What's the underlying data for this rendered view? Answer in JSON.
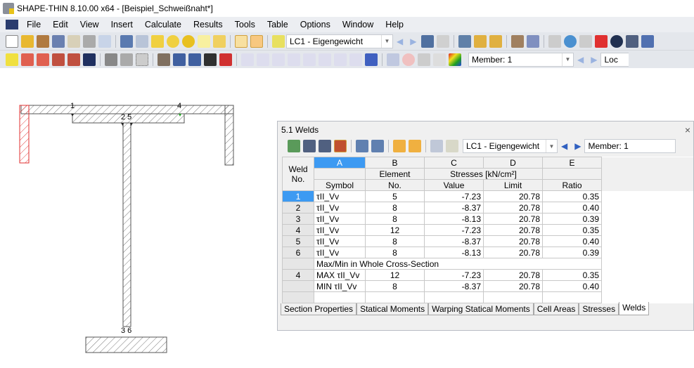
{
  "window": {
    "title": "SHAPE-THIN 8.10.00 x64 - [Beispiel_Schweißnaht*]"
  },
  "menu": [
    "File",
    "Edit",
    "View",
    "Insert",
    "Calculate",
    "Results",
    "Tools",
    "Table",
    "Options",
    "Window",
    "Help"
  ],
  "toolbar": {
    "load_case": "LC1 - Eigengewicht",
    "member": "Member: 1",
    "loc_partial": "Loc"
  },
  "drawing": {
    "labels": [
      "1",
      "2 5",
      "4",
      "3 6"
    ]
  },
  "colors": {
    "accent": "#3d9af2",
    "weld": "#e03030"
  },
  "panel": {
    "title": "5.1 Welds",
    "close": "×",
    "load_case": "LC1 - Eigengewicht",
    "member": "Member: 1",
    "columns": [
      "A",
      "B",
      "C",
      "D",
      "E"
    ],
    "headers": {
      "weld": "Weld",
      "no": "No.",
      "element": "Element",
      "stresses": "Stresses [kN/cm²]",
      "symbol": "Symbol",
      "elem_no": "No.",
      "value": "Value",
      "limit": "Limit",
      "ratio": "Ratio"
    },
    "rows": [
      {
        "no": "1",
        "symbol": "τII_Vv",
        "element": "5",
        "value": "-7.23",
        "limit": "20.78",
        "ratio": "0.35"
      },
      {
        "no": "2",
        "symbol": "τII_Vv",
        "element": "8",
        "value": "-8.37",
        "limit": "20.78",
        "ratio": "0.40"
      },
      {
        "no": "3",
        "symbol": "τII_Vv",
        "element": "8",
        "value": "-8.13",
        "limit": "20.78",
        "ratio": "0.39"
      },
      {
        "no": "4",
        "symbol": "τII_Vv",
        "element": "12",
        "value": "-7.23",
        "limit": "20.78",
        "ratio": "0.35"
      },
      {
        "no": "5",
        "symbol": "τII_Vv",
        "element": "8",
        "value": "-8.37",
        "limit": "20.78",
        "ratio": "0.40"
      },
      {
        "no": "6",
        "symbol": "τII_Vv",
        "element": "8",
        "value": "-8.13",
        "limit": "20.78",
        "ratio": "0.39"
      }
    ],
    "section_label": "Max/Min in Whole Cross-Section",
    "max": {
      "no": "4",
      "symbol": "MAX τII_Vv",
      "element": "12",
      "value": "-7.23",
      "limit": "20.78",
      "ratio": "0.35"
    },
    "min": {
      "no": "",
      "symbol": "MIN τII_Vv",
      "element": "8",
      "value": "-8.37",
      "limit": "20.78",
      "ratio": "0.40"
    },
    "tabs": [
      "Section Properties",
      "Statical Moments",
      "Warping Statical Moments",
      "Cell Areas",
      "Stresses",
      "Welds"
    ]
  }
}
